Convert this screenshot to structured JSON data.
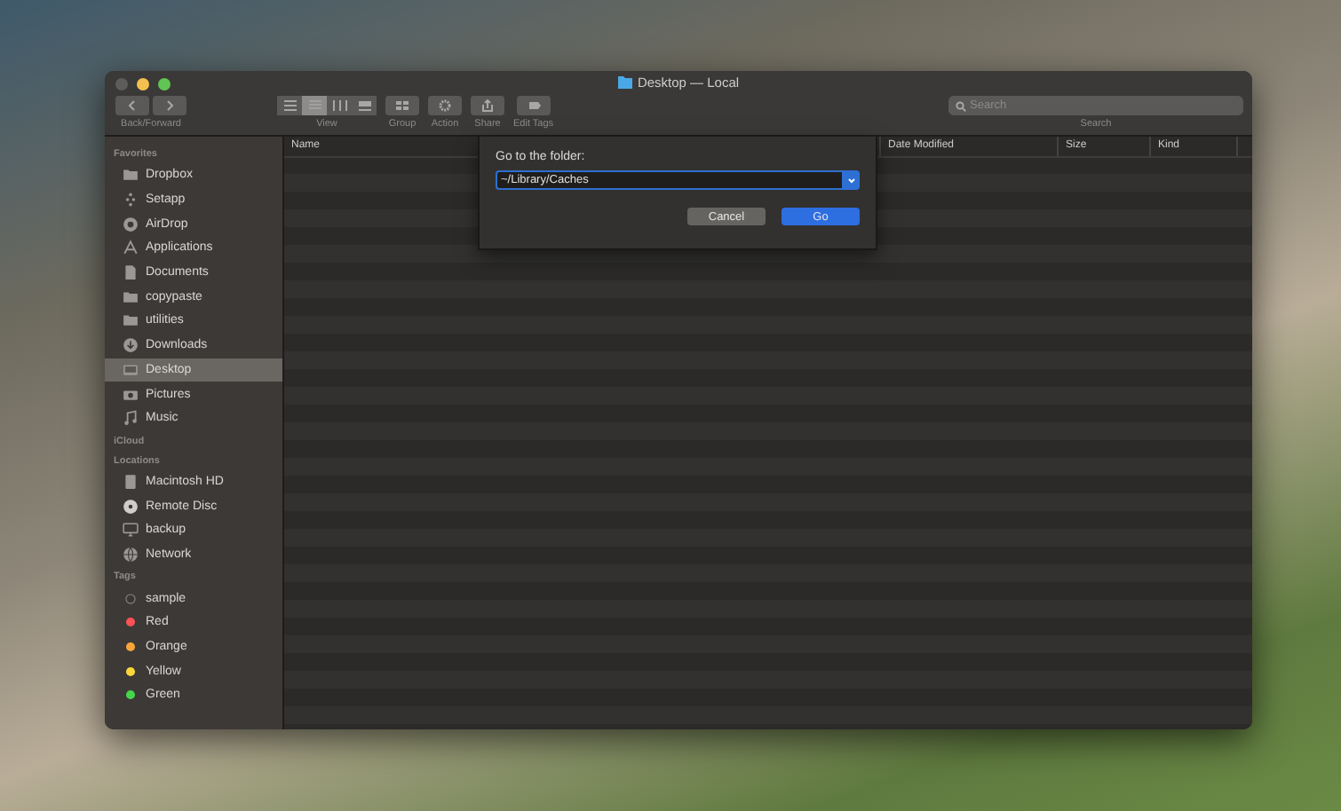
{
  "window": {
    "title": "Desktop — Local"
  },
  "toolbar": {
    "groups": [
      {
        "kind": "nav",
        "label": "Back/Forward"
      },
      {
        "kind": "view",
        "label": "View"
      },
      {
        "kind": "group",
        "label": "Group"
      },
      {
        "kind": "action",
        "label": "Action"
      },
      {
        "kind": "share",
        "label": "Share"
      },
      {
        "kind": "tags",
        "label": "Edit Tags"
      }
    ],
    "view_modes": [
      {
        "selected": false
      },
      {
        "selected": true
      },
      {
        "selected": false
      },
      {
        "selected": false
      }
    ],
    "search": {
      "placeholder": "Search",
      "label": "Search"
    }
  },
  "sidebar": {
    "sections": [
      {
        "title": "Favorites",
        "items": [
          {
            "label": "Dropbox",
            "kind": "folder",
            "selected": false
          },
          {
            "label": "Setapp",
            "kind": "setapp",
            "selected": false
          },
          {
            "label": "AirDrop",
            "kind": "airdrop",
            "selected": false
          },
          {
            "label": "Applications",
            "kind": "apps",
            "selected": false
          },
          {
            "label": "Documents",
            "kind": "doc",
            "selected": false
          },
          {
            "label": "copypaste",
            "kind": "folder",
            "selected": false
          },
          {
            "label": "utilities",
            "kind": "folder",
            "selected": false
          },
          {
            "label": "Downloads",
            "kind": "download",
            "selected": false
          },
          {
            "label": "Desktop",
            "kind": "desktop",
            "selected": true
          },
          {
            "label": "Pictures",
            "kind": "camera",
            "selected": false
          },
          {
            "label": "Music",
            "kind": "music",
            "selected": false
          }
        ]
      },
      {
        "title": "iCloud"
      },
      {
        "title": "Locations",
        "items": [
          {
            "label": "Macintosh HD",
            "kind": "disk",
            "selected": false
          },
          {
            "label": "Remote Disc",
            "kind": "disc",
            "selected": false
          },
          {
            "label": "backup",
            "kind": "monitor",
            "selected": false
          },
          {
            "label": "Network",
            "kind": "globe",
            "selected": false
          }
        ]
      },
      {
        "title": "Tags",
        "items": [
          {
            "label": "sample",
            "kind": "tag",
            "color": "#3a3836",
            "selected": false
          },
          {
            "label": "Red",
            "kind": "tag",
            "color": "#ff5257",
            "selected": false
          },
          {
            "label": "Orange",
            "kind": "tag",
            "color": "#f7a43a",
            "selected": false
          },
          {
            "label": "Yellow",
            "kind": "tag",
            "color": "#fcd63a",
            "selected": false
          },
          {
            "label": "Green",
            "kind": "tag",
            "color": "#45d64c",
            "selected": false
          }
        ]
      }
    ]
  },
  "table": {
    "columns": [
      "Name",
      "Date Modified",
      "Size",
      "Kind"
    ]
  },
  "dialog": {
    "title": "Go to the folder:",
    "value": "~/Library/Caches",
    "buttons": [
      {
        "label": "Cancel",
        "kind": "cancel"
      },
      {
        "label": "Go",
        "kind": "default"
      }
    ]
  }
}
